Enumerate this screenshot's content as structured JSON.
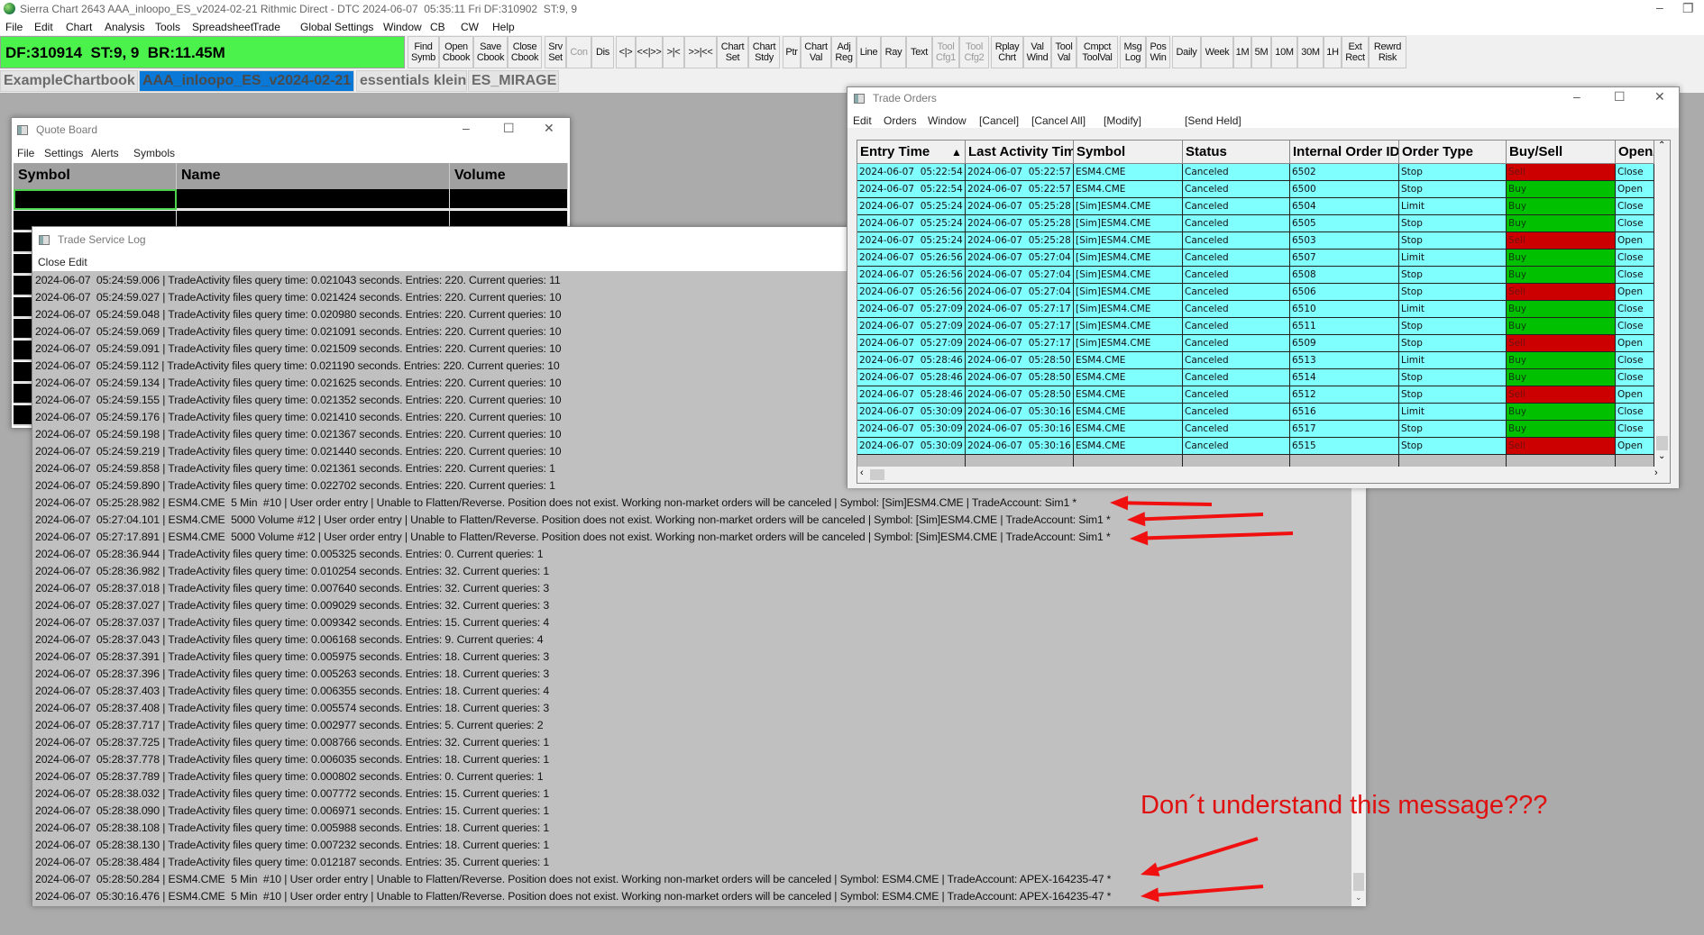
{
  "app": {
    "title": "Sierra Chart 2643 AAA_inloopo_ES_v2024-02-21 Rithmic Direct - DTC 2024-06-07  05:35:11 Fri DF:310902  ST:9, 9",
    "menu": [
      "File",
      "Edit",
      "Chart",
      "Analysis",
      "Tools",
      "Spreadsheet",
      "Trade",
      "Global Settings",
      "Window",
      "CB",
      "CW",
      "Help"
    ],
    "status_text": "DF:310914  ST:9, 9  BR:11.45M",
    "toolbar": [
      {
        "label": "Find\nSymb"
      },
      {
        "label": "Open\nCbook"
      },
      {
        "label": "Save\nCbook"
      },
      {
        "label": "Close\nCbook"
      },
      {
        "label": "Srv\nSet"
      },
      {
        "label": "Con",
        "disabled": true
      },
      {
        "label": "Dis"
      },
      {
        "label": "<|>"
      },
      {
        "label": "<<|>>"
      },
      {
        "label": ">|<"
      },
      {
        "label": ">>|<<"
      },
      {
        "label": "Chart\nSet"
      },
      {
        "label": "Chart\nStdy"
      },
      {
        "label": "Ptr"
      },
      {
        "label": "Chart\nVal"
      },
      {
        "label": "Adj\nReg"
      },
      {
        "label": "Line"
      },
      {
        "label": "Ray"
      },
      {
        "label": "Text"
      },
      {
        "label": "Tool\nCfg1",
        "disabled": true
      },
      {
        "label": "Tool\nCfg2",
        "disabled": true
      },
      {
        "label": "Rplay\nChrt"
      },
      {
        "label": "Val\nWind"
      },
      {
        "label": "Tool\nVal"
      },
      {
        "label": "Cmpct\nToolVal"
      },
      {
        "label": "Msg\nLog"
      },
      {
        "label": "Pos\nWin"
      },
      {
        "label": "Daily"
      },
      {
        "label": "Week"
      },
      {
        "label": "1M"
      },
      {
        "label": "5M"
      },
      {
        "label": "10M"
      },
      {
        "label": "30M"
      },
      {
        "label": "1H"
      },
      {
        "label": "Ext\nRect"
      },
      {
        "label": "Rewrd\nRisk"
      }
    ],
    "tabs": [
      {
        "label": "ExampleChartbook"
      },
      {
        "label": "AAA_inloopo_ES_v2024-02-21",
        "active": true
      },
      {
        "label": "essentials klein"
      },
      {
        "label": "ES_MIRAGE"
      }
    ]
  },
  "quote_board": {
    "title": "Quote Board",
    "menu": [
      "File",
      "Settings",
      "Alerts",
      "Symbols"
    ],
    "columns": [
      "Symbol",
      "Name",
      "Volume"
    ]
  },
  "trade_log": {
    "title": "Trade Service Log",
    "menu": [
      "Close",
      "Edit"
    ],
    "lines": [
      "2024-06-07  05:24:59.006 | TradeActivity files query time: 0.021043 seconds. Entries: 220. Current queries: 11",
      "2024-06-07  05:24:59.027 | TradeActivity files query time: 0.021424 seconds. Entries: 220. Current queries: 10",
      "2024-06-07  05:24:59.048 | TradeActivity files query time: 0.020980 seconds. Entries: 220. Current queries: 10",
      "2024-06-07  05:24:59.069 | TradeActivity files query time: 0.021091 seconds. Entries: 220. Current queries: 10",
      "2024-06-07  05:24:59.091 | TradeActivity files query time: 0.021509 seconds. Entries: 220. Current queries: 10",
      "2024-06-07  05:24:59.112 | TradeActivity files query time: 0.021190 seconds. Entries: 220. Current queries: 10",
      "2024-06-07  05:24:59.134 | TradeActivity files query time: 0.021625 seconds. Entries: 220. Current queries: 10",
      "2024-06-07  05:24:59.155 | TradeActivity files query time: 0.021352 seconds. Entries: 220. Current queries: 10",
      "2024-06-07  05:24:59.176 | TradeActivity files query time: 0.021410 seconds. Entries: 220. Current queries: 10",
      "2024-06-07  05:24:59.198 | TradeActivity files query time: 0.021367 seconds. Entries: 220. Current queries: 10",
      "2024-06-07  05:24:59.219 | TradeActivity files query time: 0.021440 seconds. Entries: 220. Current queries: 10",
      "2024-06-07  05:24:59.858 | TradeActivity files query time: 0.021361 seconds. Entries: 220. Current queries: 1",
      "2024-06-07  05:24:59.890 | TradeActivity files query time: 0.022702 seconds. Entries: 220. Current queries: 1",
      "2024-06-07  05:25:28.982 | ESM4.CME  5 Min  #10 | User order entry | Unable to Flatten/Reverse. Position does not exist. Working non-market orders will be canceled | Symbol: [Sim]ESM4.CME | TradeAccount: Sim1 *",
      "2024-06-07  05:27:04.101 | ESM4.CME  5000 Volume #12 | User order entry | Unable to Flatten/Reverse. Position does not exist. Working non-market orders will be canceled | Symbol: [Sim]ESM4.CME | TradeAccount: Sim1 *",
      "2024-06-07  05:27:17.891 | ESM4.CME  5000 Volume #12 | User order entry | Unable to Flatten/Reverse. Position does not exist. Working non-market orders will be canceled | Symbol: [Sim]ESM4.CME | TradeAccount: Sim1 *",
      "2024-06-07  05:28:36.944 | TradeActivity files query time: 0.005325 seconds. Entries: 0. Current queries: 1",
      "2024-06-07  05:28:36.982 | TradeActivity files query time: 0.010254 seconds. Entries: 32. Current queries: 1",
      "2024-06-07  05:28:37.018 | TradeActivity files query time: 0.007640 seconds. Entries: 32. Current queries: 3",
      "2024-06-07  05:28:37.027 | TradeActivity files query time: 0.009029 seconds. Entries: 32. Current queries: 3",
      "2024-06-07  05:28:37.037 | TradeActivity files query time: 0.009342 seconds. Entries: 15. Current queries: 4",
      "2024-06-07  05:28:37.043 | TradeActivity files query time: 0.006168 seconds. Entries: 9. Current queries: 4",
      "2024-06-07  05:28:37.391 | TradeActivity files query time: 0.005975 seconds. Entries: 18. Current queries: 3",
      "2024-06-07  05:28:37.396 | TradeActivity files query time: 0.005263 seconds. Entries: 18. Current queries: 3",
      "2024-06-07  05:28:37.403 | TradeActivity files query time: 0.006355 seconds. Entries: 18. Current queries: 4",
      "2024-06-07  05:28:37.408 | TradeActivity files query time: 0.005574 seconds. Entries: 18. Current queries: 3",
      "2024-06-07  05:28:37.717 | TradeActivity files query time: 0.002977 seconds. Entries: 5. Current queries: 2",
      "2024-06-07  05:28:37.725 | TradeActivity files query time: 0.008766 seconds. Entries: 32. Current queries: 1",
      "2024-06-07  05:28:37.778 | TradeActivity files query time: 0.006035 seconds. Entries: 18. Current queries: 1",
      "2024-06-07  05:28:37.789 | TradeActivity files query time: 0.000802 seconds. Entries: 0. Current queries: 1",
      "2024-06-07  05:28:38.032 | TradeActivity files query time: 0.007772 seconds. Entries: 15. Current queries: 1",
      "2024-06-07  05:28:38.090 | TradeActivity files query time: 0.006971 seconds. Entries: 15. Current queries: 1",
      "2024-06-07  05:28:38.108 | TradeActivity files query time: 0.005988 seconds. Entries: 18. Current queries: 1",
      "2024-06-07  05:28:38.130 | TradeActivity files query time: 0.007232 seconds. Entries: 18. Current queries: 1",
      "2024-06-07  05:28:38.484 | TradeActivity files query time: 0.012187 seconds. Entries: 35. Current queries: 1",
      "2024-06-07  05:28:50.284 | ESM4.CME  5 Min  #10 | User order entry | Unable to Flatten/Reverse. Position does not exist. Working non-market orders will be canceled | Symbol: ESM4.CME | TradeAccount: APEX-164235-47 *",
      "2024-06-07  05:30:16.476 | ESM4.CME  5 Min  #10 | User order entry | Unable to Flatten/Reverse. Position does not exist. Working non-market orders will be canceled | Symbol: ESM4.CME | TradeAccount: APEX-164235-47 *"
    ]
  },
  "trade_orders": {
    "title": "Trade Orders",
    "menu": [
      "Edit",
      "Orders",
      "Window",
      "[Cancel]",
      "[Cancel All]",
      "[Modify]",
      "[Send Held]"
    ],
    "columns": [
      "Entry Time",
      "Last Activity Time",
      "Symbol",
      "Status",
      "Internal Order ID",
      "Order Type",
      "Buy/Sell",
      "Open/Close"
    ],
    "sort_indicator": "▲",
    "rows": [
      [
        "2024-06-07  05:22:54",
        "2024-06-07  05:22:57",
        "ESM4.CME",
        "Canceled",
        "6502",
        "Stop",
        "Sell",
        "Close"
      ],
      [
        "2024-06-07  05:22:54",
        "2024-06-07  05:22:57",
        "ESM4.CME",
        "Canceled",
        "6500",
        "Stop",
        "Buy",
        "Open"
      ],
      [
        "2024-06-07  05:25:24",
        "2024-06-07  05:25:28",
        "[Sim]ESM4.CME",
        "Canceled",
        "6504",
        "Limit",
        "Buy",
        "Close"
      ],
      [
        "2024-06-07  05:25:24",
        "2024-06-07  05:25:28",
        "[Sim]ESM4.CME",
        "Canceled",
        "6505",
        "Stop",
        "Buy",
        "Close"
      ],
      [
        "2024-06-07  05:25:24",
        "2024-06-07  05:25:28",
        "[Sim]ESM4.CME",
        "Canceled",
        "6503",
        "Stop",
        "Sell",
        "Open"
      ],
      [
        "2024-06-07  05:26:56",
        "2024-06-07  05:27:04",
        "[Sim]ESM4.CME",
        "Canceled",
        "6507",
        "Limit",
        "Buy",
        "Close"
      ],
      [
        "2024-06-07  05:26:56",
        "2024-06-07  05:27:04",
        "[Sim]ESM4.CME",
        "Canceled",
        "6508",
        "Stop",
        "Buy",
        "Close"
      ],
      [
        "2024-06-07  05:26:56",
        "2024-06-07  05:27:04",
        "[Sim]ESM4.CME",
        "Canceled",
        "6506",
        "Stop",
        "Sell",
        "Open"
      ],
      [
        "2024-06-07  05:27:09",
        "2024-06-07  05:27:17",
        "[Sim]ESM4.CME",
        "Canceled",
        "6510",
        "Limit",
        "Buy",
        "Close"
      ],
      [
        "2024-06-07  05:27:09",
        "2024-06-07  05:27:17",
        "[Sim]ESM4.CME",
        "Canceled",
        "6511",
        "Stop",
        "Buy",
        "Close"
      ],
      [
        "2024-06-07  05:27:09",
        "2024-06-07  05:27:17",
        "[Sim]ESM4.CME",
        "Canceled",
        "6509",
        "Stop",
        "Sell",
        "Open"
      ],
      [
        "2024-06-07  05:28:46",
        "2024-06-07  05:28:50",
        "ESM4.CME",
        "Canceled",
        "6513",
        "Limit",
        "Buy",
        "Close"
      ],
      [
        "2024-06-07  05:28:46",
        "2024-06-07  05:28:50",
        "ESM4.CME",
        "Canceled",
        "6514",
        "Stop",
        "Buy",
        "Close"
      ],
      [
        "2024-06-07  05:28:46",
        "2024-06-07  05:28:50",
        "ESM4.CME",
        "Canceled",
        "6512",
        "Stop",
        "Sell",
        "Open"
      ],
      [
        "2024-06-07  05:30:09",
        "2024-06-07  05:30:16",
        "ESM4.CME",
        "Canceled",
        "6516",
        "Limit",
        "Buy",
        "Close"
      ],
      [
        "2024-06-07  05:30:09",
        "2024-06-07  05:30:16",
        "ESM4.CME",
        "Canceled",
        "6517",
        "Stop",
        "Buy",
        "Close"
      ],
      [
        "2024-06-07  05:30:09",
        "2024-06-07  05:30:16",
        "ESM4.CME",
        "Canceled",
        "6515",
        "Stop",
        "Sell",
        "Open"
      ]
    ]
  },
  "annotation": {
    "text": "Don´t understand this message???",
    "color": "#e01010"
  },
  "colors": {
    "status_green": "#4cf24c",
    "row_cyan": "#80ffff",
    "buy": "#00c000",
    "sell": "#cc0000",
    "tab_active": "#0a78d6"
  }
}
